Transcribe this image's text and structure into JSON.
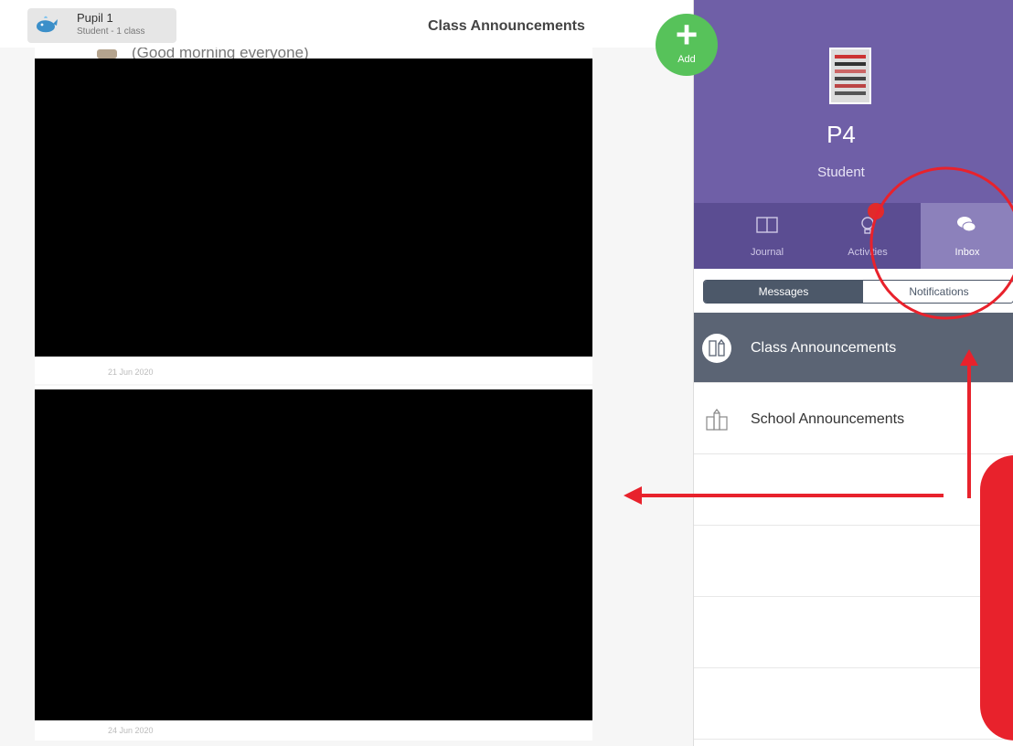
{
  "header": {
    "user_name": "Pupil 1",
    "user_sub": "Student - 1 class",
    "title": "Class Announcements"
  },
  "feed": {
    "posts": [
      {
        "caption": "(Good morning everyone)",
        "date": "21 Jun 2020"
      },
      {
        "date": "24 Jun 2020"
      }
    ]
  },
  "add_button": {
    "label": "Add",
    "color": "#57c25a"
  },
  "profile": {
    "name": "P4",
    "role": "Student",
    "color": "#6f5fa7"
  },
  "nav": {
    "tabs": [
      {
        "label": "Journal",
        "icon": "book-icon"
      },
      {
        "label": "Activities",
        "icon": "lightbulb-icon"
      },
      {
        "label": "Inbox",
        "icon": "chat-bubbles-icon",
        "active": true
      }
    ]
  },
  "segments": {
    "messages": "Messages",
    "notifications": "Notifications",
    "selected": "Messages"
  },
  "inbox_list": [
    {
      "label": "Class Announcements",
      "icon": "pencil-ruler-icon",
      "active": true
    },
    {
      "label": "School Announcements",
      "icon": "school-building-icon"
    }
  ],
  "annotation_color": "#e8222c"
}
